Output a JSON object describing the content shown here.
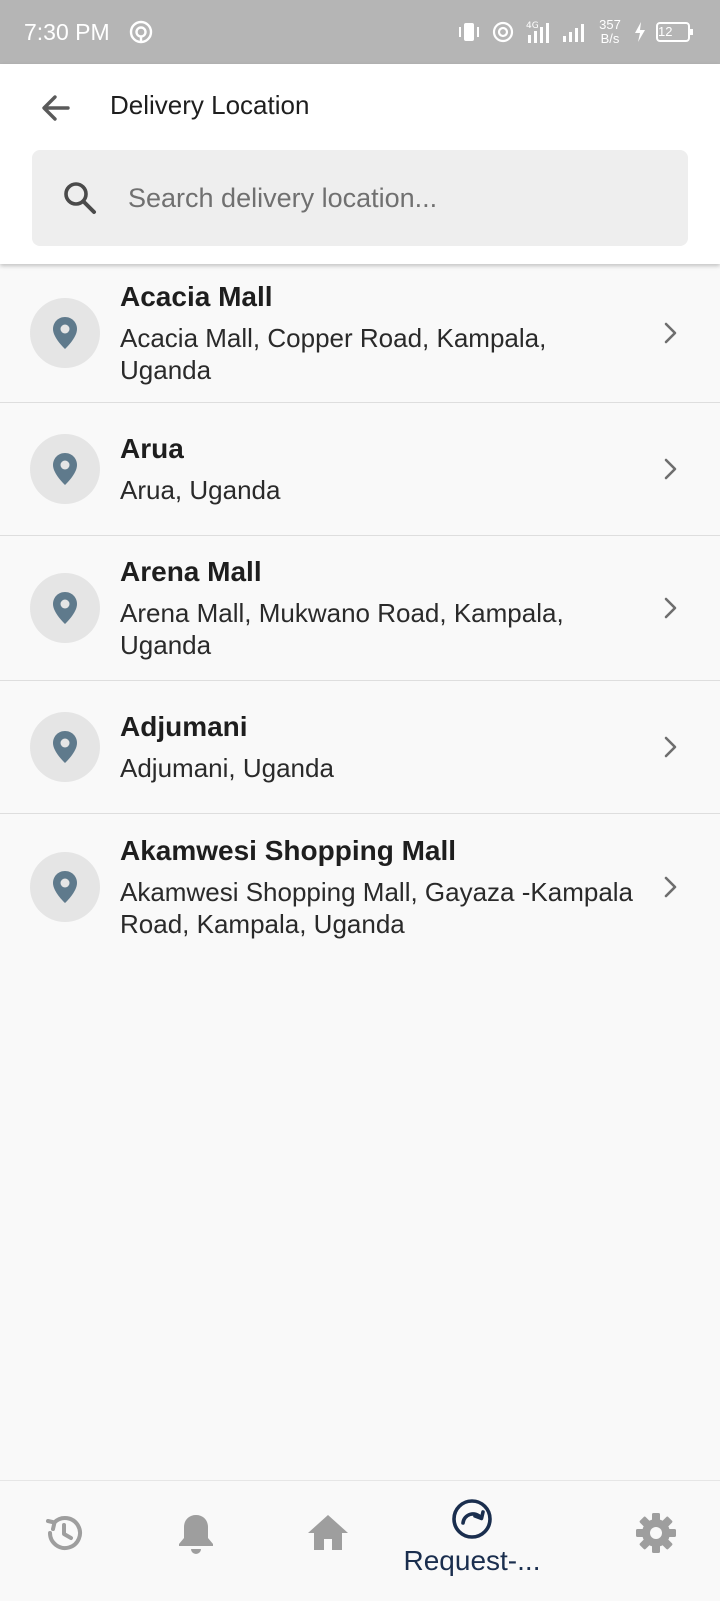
{
  "status_bar": {
    "time": "7:30 PM",
    "network": "4G",
    "net_speed_value": "357",
    "net_speed_unit": "B/s",
    "battery": "12"
  },
  "header": {
    "title": "Delivery Location",
    "back_icon": "arrow-left-icon"
  },
  "search": {
    "placeholder": "Search delivery location...",
    "value": ""
  },
  "locations": [
    {
      "name": "Acacia Mall",
      "address": "Acacia Mall, Copper Road, Kampala, Uganda"
    },
    {
      "name": "Arua",
      "address": "Arua, Uganda"
    },
    {
      "name": "Arena Mall",
      "address": "Arena Mall, Mukwano Road, Kampala, Uganda"
    },
    {
      "name": "Adjumani",
      "address": "Adjumani, Uganda"
    },
    {
      "name": "Akamwesi Shopping Mall",
      "address": "Akamwesi Shopping Mall, Gayaza -Kampala Road, Kampala, Uganda"
    }
  ],
  "bottom_nav": {
    "items": [
      {
        "icon": "history-icon"
      },
      {
        "icon": "bell-icon"
      },
      {
        "icon": "home-icon"
      },
      {
        "icon": "request-icon",
        "label": "Request-...",
        "active": true
      },
      {
        "icon": "gear-icon"
      }
    ]
  },
  "colors": {
    "status_bar": "#b5b5b5",
    "pin": "#5f7a8c",
    "pin_bg": "#e5e5e5",
    "active_nav": "#1a2e4e",
    "inactive_nav": "#9e9e9e"
  }
}
